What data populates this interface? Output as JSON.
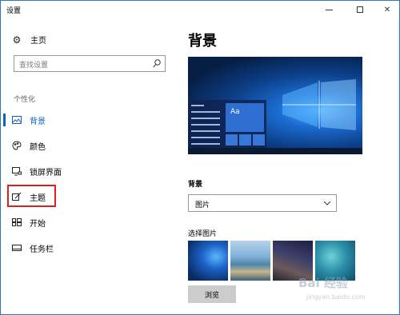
{
  "window": {
    "title": "设置",
    "controls": {
      "minimize": "",
      "maximize": "",
      "close": "✕"
    }
  },
  "sidebar": {
    "home_label": "主页",
    "search_placeholder": "查找设置",
    "section_label": "个性化",
    "items": [
      {
        "label": "背景",
        "icon": "picture-icon",
        "active": true
      },
      {
        "label": "颜色",
        "icon": "palette-icon",
        "active": false
      },
      {
        "label": "锁屏界面",
        "icon": "monitor-lock-icon",
        "active": false
      },
      {
        "label": "主题",
        "icon": "brush-icon",
        "active": false,
        "highlighted": true
      },
      {
        "label": "开始",
        "icon": "start-tiles-icon",
        "active": false
      },
      {
        "label": "任务栏",
        "icon": "taskbar-icon",
        "active": false
      }
    ]
  },
  "main": {
    "title": "背景",
    "preview_tile_label": "Aa",
    "background_label": "背景",
    "background_value": "图片",
    "choose_picture_label": "选择图片",
    "browse_label": "浏览"
  },
  "watermark": {
    "text": "Bai 经验",
    "sub": "jingyan.baidu.com"
  },
  "colors": {
    "accent": "#0b63c9",
    "highlight_box": "#e02020",
    "window_border": "#2b78c5"
  }
}
